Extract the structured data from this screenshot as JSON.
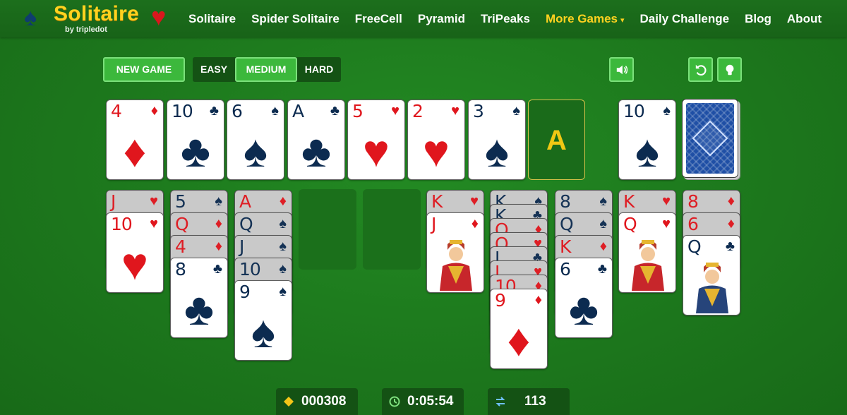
{
  "brand": {
    "title": "Solitaire",
    "byline": "by tripledot",
    "spade_symbol": "♠",
    "heart_symbol": "♥"
  },
  "nav": {
    "items": [
      "Solitaire",
      "Spider Solitaire",
      "FreeCell",
      "Pyramid",
      "TriPeaks",
      "More Games",
      "Daily Challenge",
      "Blog",
      "About"
    ],
    "caret": "▾"
  },
  "controls": {
    "new_game": "NEW GAME",
    "difficulty": [
      "EASY",
      "MEDIUM",
      "HARD"
    ],
    "selected_difficulty": "MEDIUM",
    "sound_icon": "speaker-icon",
    "undo_icon": "undo-icon",
    "hint_icon": "lightbulb-icon"
  },
  "colors": {
    "felt": "#1f7d1f",
    "accent_green": "#3cb83c",
    "gold": "#ffd21f",
    "red_suit": "#e0161d",
    "black_suit": "#0c2b50"
  },
  "top_row": {
    "cards": [
      {
        "rank": "4",
        "suit": "♦",
        "color": "red"
      },
      {
        "rank": "10",
        "suit": "♣",
        "color": "black"
      },
      {
        "rank": "6",
        "suit": "♠",
        "color": "black"
      },
      {
        "rank": "A",
        "suit": "♣",
        "color": "black"
      },
      {
        "rank": "5",
        "suit": "♥",
        "color": "red"
      },
      {
        "rank": "2",
        "suit": "♥",
        "color": "red"
      },
      {
        "rank": "3",
        "suit": "♠",
        "color": "black"
      }
    ],
    "foundation_placeholder": "A",
    "waste": {
      "rank": "10",
      "suit": "♠",
      "color": "black"
    }
  },
  "tableau": {
    "col1": [
      {
        "rank": "J",
        "suit": "♥",
        "color": "red"
      },
      {
        "rank": "10",
        "suit": "♥",
        "color": "red"
      }
    ],
    "col2": [
      {
        "rank": "5",
        "suit": "♠",
        "color": "black"
      },
      {
        "rank": "Q",
        "suit": "♦",
        "color": "red"
      },
      {
        "rank": "4",
        "suit": "♦",
        "color": "red"
      },
      {
        "rank": "8",
        "suit": "♣",
        "color": "black"
      }
    ],
    "col3": [
      {
        "rank": "A",
        "suit": "♦",
        "color": "red"
      },
      {
        "rank": "Q",
        "suit": "♠",
        "color": "black"
      },
      {
        "rank": "J",
        "suit": "♠",
        "color": "black"
      },
      {
        "rank": "10",
        "suit": "♠",
        "color": "black"
      },
      {
        "rank": "9",
        "suit": "♠",
        "color": "black"
      }
    ],
    "col6": [
      {
        "rank": "K",
        "suit": "♥",
        "color": "red"
      },
      {
        "rank": "J",
        "suit": "♦",
        "color": "red"
      }
    ],
    "col7": [
      {
        "rank": "K",
        "suit": "♠",
        "color": "black"
      },
      {
        "rank": "K",
        "suit": "♣",
        "color": "black"
      },
      {
        "rank": "Q",
        "suit": "♦",
        "color": "red"
      },
      {
        "rank": "Q",
        "suit": "♥",
        "color": "red"
      },
      {
        "rank": "J",
        "suit": "♣",
        "color": "black"
      },
      {
        "rank": "J",
        "suit": "♥",
        "color": "red"
      },
      {
        "rank": "10",
        "suit": "♦",
        "color": "red"
      },
      {
        "rank": "9",
        "suit": "♦",
        "color": "red"
      }
    ],
    "col8": [
      {
        "rank": "8",
        "suit": "♠",
        "color": "black"
      },
      {
        "rank": "Q",
        "suit": "♠",
        "color": "black"
      },
      {
        "rank": "K",
        "suit": "♦",
        "color": "red"
      },
      {
        "rank": "6",
        "suit": "♣",
        "color": "black"
      }
    ],
    "col9": [
      {
        "rank": "K",
        "suit": "♥",
        "color": "red"
      },
      {
        "rank": "Q",
        "suit": "♥",
        "color": "red"
      }
    ],
    "col10": [
      {
        "rank": "8",
        "suit": "♦",
        "color": "red"
      },
      {
        "rank": "6",
        "suit": "♦",
        "color": "red"
      },
      {
        "rank": "Q",
        "suit": "♣",
        "color": "black"
      }
    ]
  },
  "stats": {
    "score": "000308",
    "time": "0:05:54",
    "moves": "113"
  }
}
